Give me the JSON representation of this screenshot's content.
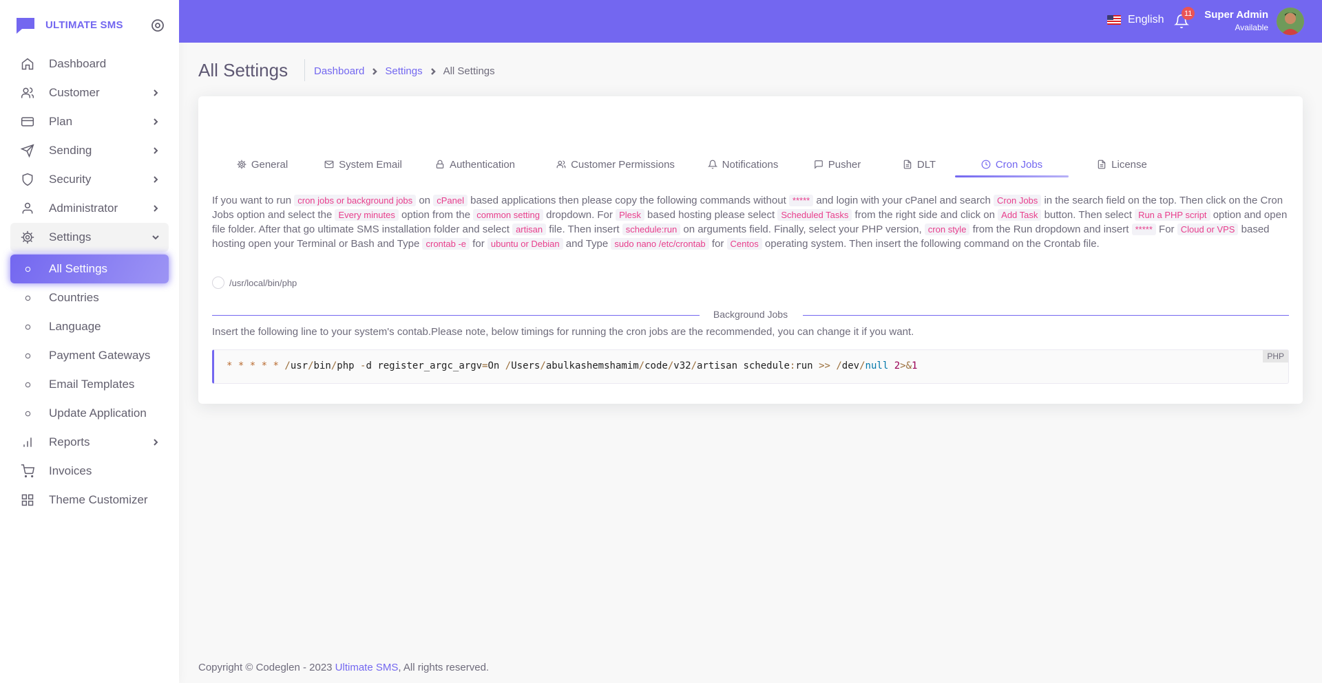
{
  "brand": {
    "name": "ULTIMATE SMS"
  },
  "sidebar": {
    "items": [
      {
        "label": "Dashboard",
        "icon": "home-icon",
        "has_children": false
      },
      {
        "label": "Customer",
        "icon": "users-icon",
        "has_children": true
      },
      {
        "label": "Plan",
        "icon": "credit-card-icon",
        "has_children": true
      },
      {
        "label": "Sending",
        "icon": "send-icon",
        "has_children": true
      },
      {
        "label": "Security",
        "icon": "shield-icon",
        "has_children": true
      },
      {
        "label": "Administrator",
        "icon": "user-icon",
        "has_children": true
      },
      {
        "label": "Settings",
        "icon": "gear-icon",
        "has_children": true,
        "open": true
      }
    ],
    "settings_children": [
      {
        "label": "All Settings",
        "active": true
      },
      {
        "label": "Countries"
      },
      {
        "label": "Language"
      },
      {
        "label": "Payment Gateways"
      },
      {
        "label": "Email Templates"
      },
      {
        "label": "Update Application"
      }
    ],
    "items_after": [
      {
        "label": "Reports",
        "icon": "bar-chart-icon",
        "has_children": true
      },
      {
        "label": "Invoices",
        "icon": "cart-icon",
        "has_children": false
      },
      {
        "label": "Theme Customizer",
        "icon": "grid-icon",
        "has_children": false
      }
    ]
  },
  "navbar": {
    "language": "English",
    "notification_count": "11",
    "user_name": "Super Admin",
    "user_status": "Available"
  },
  "page": {
    "title": "All Settings",
    "breadcrumb": [
      "Dashboard",
      "Settings",
      "All Settings"
    ]
  },
  "tabs": [
    {
      "label": "General",
      "icon": "gear-icon"
    },
    {
      "label": "System Email",
      "icon": "mail-icon"
    },
    {
      "label": "Authentication",
      "icon": "lock-icon"
    },
    {
      "label": "Customer Permissions",
      "icon": "users-icon"
    },
    {
      "label": "Notifications",
      "icon": "bell-icon"
    },
    {
      "label": "Pusher",
      "icon": "message-icon"
    },
    {
      "label": "DLT",
      "icon": "file-icon"
    },
    {
      "label": "Cron Jobs",
      "icon": "clock-icon",
      "active": true
    },
    {
      "label": "License",
      "icon": "file-icon"
    }
  ],
  "cron": {
    "description_segments": [
      {
        "t": "If you want to run "
      },
      {
        "c": "cron jobs or background jobs"
      },
      {
        "t": " on "
      },
      {
        "c": "cPanel"
      },
      {
        "t": " based applications then please copy the following commands without "
      },
      {
        "c": "*****"
      },
      {
        "t": " and login with your cPanel and search "
      },
      {
        "c": "Cron Jobs"
      },
      {
        "t": " in the search field on the top. Then click on the Cron Jobs option and select the "
      },
      {
        "c": "Every minutes"
      },
      {
        "t": " option from the "
      },
      {
        "c": "common setting"
      },
      {
        "t": " dropdown. For "
      },
      {
        "c": "Plesk"
      },
      {
        "t": " based hosting please select "
      },
      {
        "c": "Scheduled Tasks"
      },
      {
        "t": " from the right side and click on "
      },
      {
        "c": "Add Task"
      },
      {
        "t": " button. Then select "
      },
      {
        "c": "Run a PHP script"
      },
      {
        "t": " option and open file folder. After that go ultimate SMS installation folder and select "
      },
      {
        "c": "artisan"
      },
      {
        "t": " file. Then insert "
      },
      {
        "c": "schedule:run"
      },
      {
        "t": " on arguments field. Finally, select your PHP version, "
      },
      {
        "c": "cron style"
      },
      {
        "t": " from the Run dropdown and insert "
      },
      {
        "c": "*****"
      },
      {
        "t": " For "
      },
      {
        "c": "Cloud or VPS"
      },
      {
        "t": " based hosting open your Terminal or Bash and Type "
      },
      {
        "c": "crontab -e"
      },
      {
        "t": " for "
      },
      {
        "c": "ubuntu or Debian"
      },
      {
        "t": " and Type "
      },
      {
        "c": "sudo nano /etc/crontab"
      },
      {
        "t": " for "
      },
      {
        "c": "Centos"
      },
      {
        "t": " operating system. Then insert the following command on the Crontab file."
      }
    ],
    "php_path": "/usr/local/bin/php",
    "section_title": "Background Jobs",
    "note": "Insert the following line to your system's contab.Please note, below timings for running the cron jobs are the recommended, you can change it if you want.",
    "code_lang": "PHP",
    "command_tokens": [
      {
        "s": "*",
        "k": "punct"
      },
      {
        "s": " ",
        "k": ""
      },
      {
        "s": "*",
        "k": "punct"
      },
      {
        "s": " ",
        "k": ""
      },
      {
        "s": "*",
        "k": "punct"
      },
      {
        "s": " ",
        "k": ""
      },
      {
        "s": "*",
        "k": "punct"
      },
      {
        "s": " ",
        "k": ""
      },
      {
        "s": "*",
        "k": "punct"
      },
      {
        "s": " ",
        "k": ""
      },
      {
        "s": "/",
        "k": "op"
      },
      {
        "s": "usr",
        "k": ""
      },
      {
        "s": "/",
        "k": "op"
      },
      {
        "s": "bin",
        "k": ""
      },
      {
        "s": "/",
        "k": "op"
      },
      {
        "s": "php",
        "k": ""
      },
      {
        "s": " ",
        "k": ""
      },
      {
        "s": "-",
        "k": "op"
      },
      {
        "s": "d",
        "k": ""
      },
      {
        "s": " ",
        "k": ""
      },
      {
        "s": "register_argc_argv",
        "k": ""
      },
      {
        "s": "=",
        "k": "op"
      },
      {
        "s": "On",
        "k": ""
      },
      {
        "s": " ",
        "k": ""
      },
      {
        "s": "/",
        "k": "op"
      },
      {
        "s": "Users",
        "k": ""
      },
      {
        "s": "/",
        "k": "op"
      },
      {
        "s": "abulkashemshamim",
        "k": ""
      },
      {
        "s": "/",
        "k": "op"
      },
      {
        "s": "code",
        "k": ""
      },
      {
        "s": "/",
        "k": "op"
      },
      {
        "s": "v32",
        "k": ""
      },
      {
        "s": "/",
        "k": "op"
      },
      {
        "s": "artisan",
        "k": ""
      },
      {
        "s": " ",
        "k": ""
      },
      {
        "s": "schedule",
        "k": ""
      },
      {
        "s": ":",
        "k": "op"
      },
      {
        "s": "run",
        "k": ""
      },
      {
        "s": " ",
        "k": ""
      },
      {
        "s": ">>",
        "k": "op"
      },
      {
        "s": " ",
        "k": ""
      },
      {
        "s": "/",
        "k": "op"
      },
      {
        "s": "dev",
        "k": ""
      },
      {
        "s": "/",
        "k": "op"
      },
      {
        "s": "null",
        "k": "kw"
      },
      {
        "s": " ",
        "k": ""
      },
      {
        "s": "2",
        "k": "num"
      },
      {
        "s": ">",
        "k": "op"
      },
      {
        "s": "&",
        "k": "op"
      },
      {
        "s": "1",
        "k": "num"
      }
    ]
  },
  "footer": {
    "prefix": "Copyright © Codeglen - 2023 ",
    "link": "Ultimate SMS",
    "suffix": ", All rights reserved."
  },
  "colors": {
    "primary": "#7367f0",
    "code_pink": "#e83e8c",
    "badge": "#ea5455"
  }
}
